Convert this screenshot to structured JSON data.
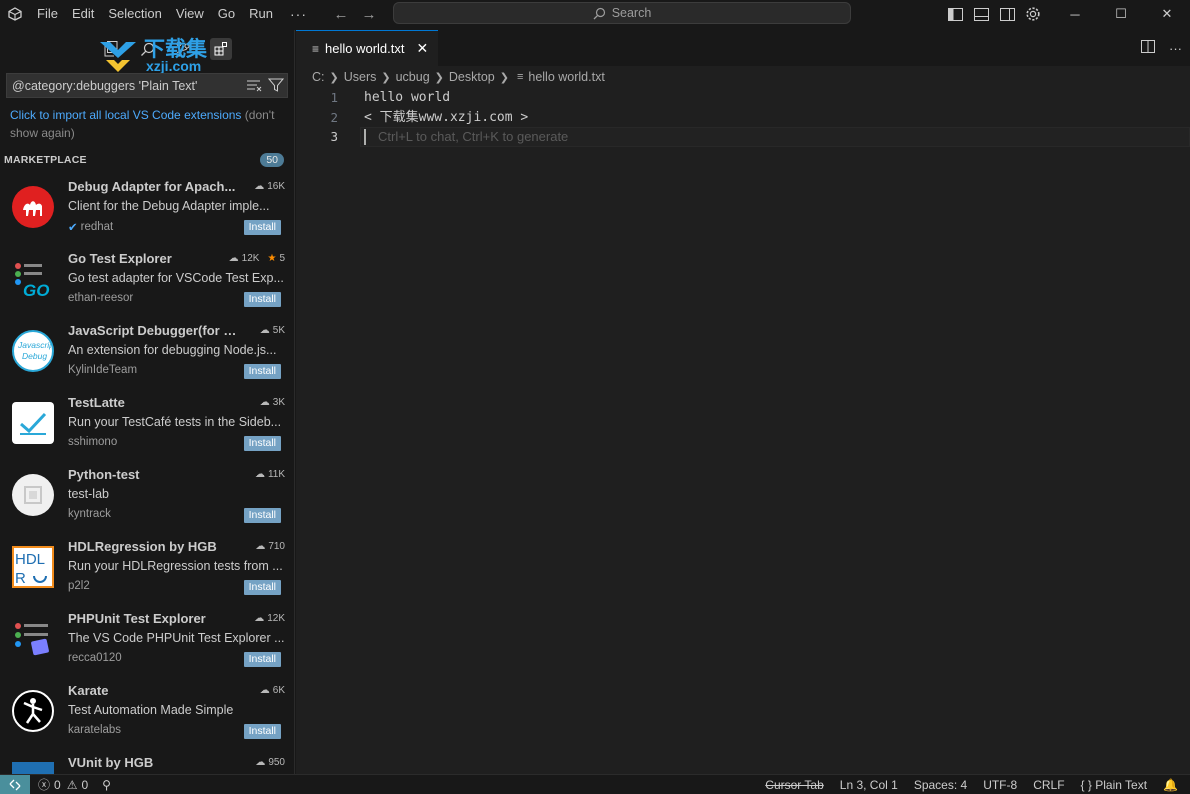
{
  "menu": [
    "File",
    "Edit",
    "Selection",
    "View",
    "Go",
    "Run",
    "···"
  ],
  "search": {
    "label": "Search"
  },
  "watermark": {
    "cn": "下载集",
    "en": "xzji.com"
  },
  "sidebar": {
    "search_value": "@category:debuggers 'Plain Text'",
    "import_link": "Click to import all local VS Code extensions",
    "import_suffix": " (don't show again)",
    "marketplace_label": "MARKETPLACE",
    "marketplace_count": "50",
    "install_label": "Install",
    "extensions": [
      {
        "name": "Debug Adapter for Apach...",
        "downloads": "16K",
        "rating": "",
        "desc": "Client for the Debug Adapter imple...",
        "publisher": "redhat",
        "verified": true,
        "icon": "camel-icon"
      },
      {
        "name": "Go Test Explorer",
        "downloads": "12K",
        "rating": "5",
        "desc": "Go test adapter for VSCode Test Exp...",
        "publisher": "ethan-reesor",
        "verified": false,
        "icon": "go-icon"
      },
      {
        "name": "JavaScript Debugger(for K...",
        "downloads": "5K",
        "rating": "",
        "desc": "An extension for debugging Node.js...",
        "publisher": "KylinIdeTeam",
        "verified": false,
        "icon": "javascript-icon"
      },
      {
        "name": "TestLatte",
        "downloads": "3K",
        "rating": "",
        "desc": "Run your TestCafé tests in the Sideb...",
        "publisher": "sshimono",
        "verified": false,
        "icon": "checkmark-icon"
      },
      {
        "name": "Python-test",
        "downloads": "11K",
        "rating": "",
        "desc": "test-lab",
        "publisher": "kyntrack",
        "verified": false,
        "icon": "placeholder-icon"
      },
      {
        "name": "HDLRegression by HGB",
        "downloads": "710",
        "rating": "",
        "desc": "Run your HDLRegression tests from ...",
        "publisher": "p2l2",
        "verified": false,
        "icon": "hdl-icon"
      },
      {
        "name": "PHPUnit Test Explorer",
        "downloads": "12K",
        "rating": "",
        "desc": "The VS Code PHPUnit Test Explorer ...",
        "publisher": "recca0120",
        "verified": false,
        "icon": "phpunit-icon"
      },
      {
        "name": "Karate",
        "downloads": "6K",
        "rating": "",
        "desc": "Test Automation Made Simple",
        "publisher": "karatelabs",
        "verified": false,
        "icon": "karate-icon"
      },
      {
        "name": "VUnit by HGB",
        "downloads": "950",
        "rating": "",
        "desc": "",
        "publisher": "",
        "verified": false,
        "icon": "vunit-icon"
      }
    ]
  },
  "editor": {
    "tab_label": "hello world.txt",
    "breadcrumb": [
      "C:",
      "Users",
      "ucbug",
      "Desktop",
      "hello world.txt"
    ],
    "lines": [
      {
        "num": "1",
        "text": "hello world"
      },
      {
        "num": "2",
        "text": "< 下载集www.xzji.com >"
      },
      {
        "num": "3",
        "text": ""
      }
    ],
    "ghost_hint": "Ctrl+L to chat, Ctrl+K to generate"
  },
  "status": {
    "errors": "0",
    "warnings": "0",
    "cursor_tab": "Cursor Tab",
    "position": "Ln 3, Col 1",
    "spaces": "Spaces: 4",
    "encoding": "UTF-8",
    "eol": "CRLF",
    "language": "Plain Text"
  },
  "colors": {
    "accent": "#0078d4",
    "link": "#4daafc",
    "install": "#75a2c4",
    "badge": "#4d7b96"
  }
}
